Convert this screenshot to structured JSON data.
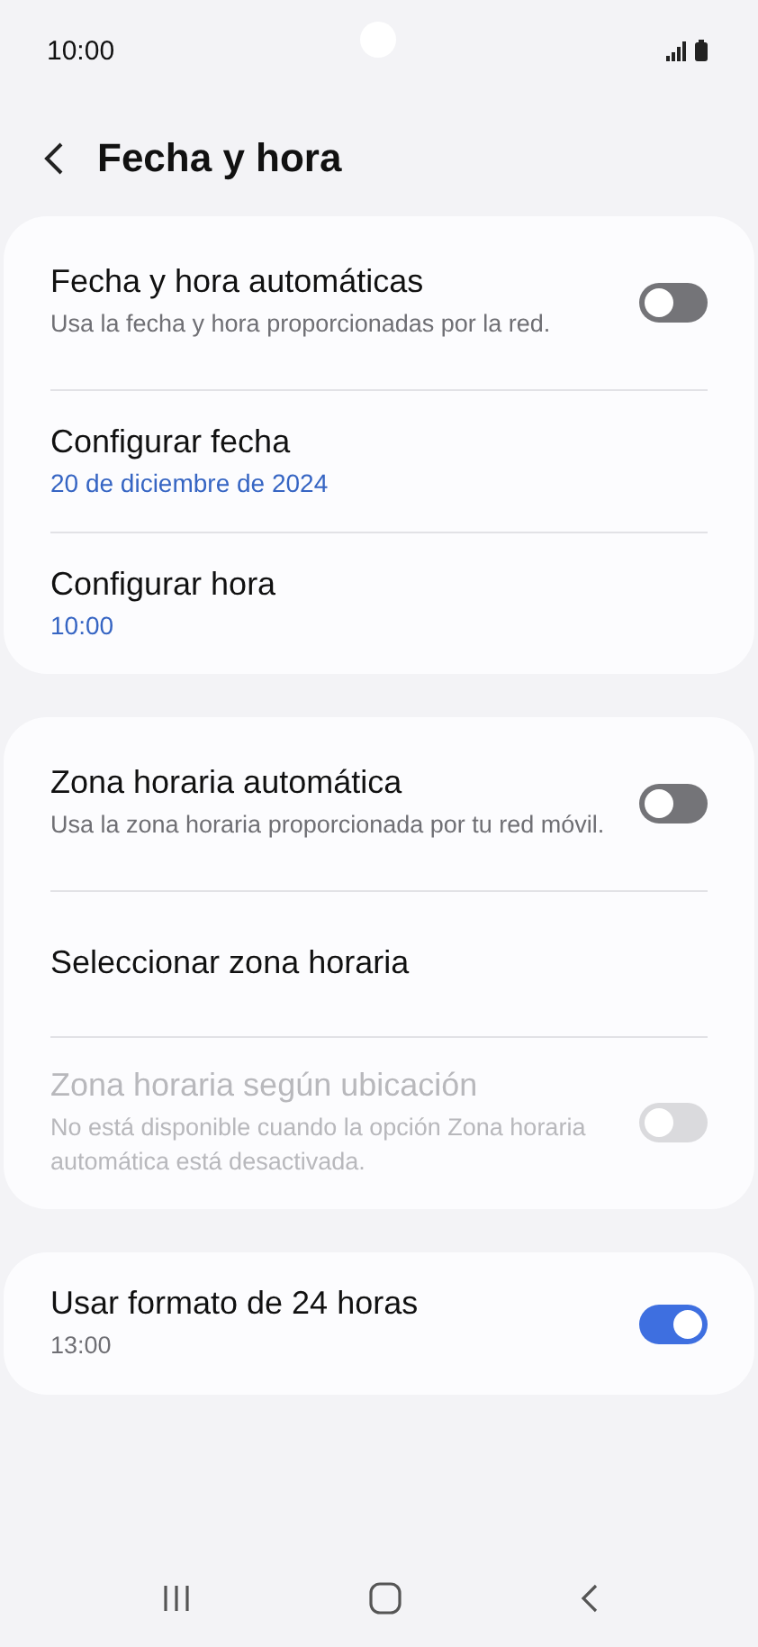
{
  "status_bar": {
    "time": "10:00"
  },
  "header": {
    "title": "Fecha y hora"
  },
  "sections": [
    {
      "items": [
        {
          "kind": "toggle",
          "title": "Fecha y hora automáticas",
          "subtitle": "Usa la fecha y hora proporcionadas por la red.",
          "on": false,
          "disabled": false
        },
        {
          "kind": "value",
          "title": "Configurar fecha",
          "value": "20 de diciembre de 2024"
        },
        {
          "kind": "value",
          "title": "Configurar hora",
          "value": "10:00"
        }
      ]
    },
    {
      "items": [
        {
          "kind": "toggle",
          "title": "Zona horaria automática",
          "subtitle": "Usa la zona horaria proporcionada por tu red móvil.",
          "on": false,
          "disabled": false
        },
        {
          "kind": "link",
          "title": "Seleccionar zona horaria"
        },
        {
          "kind": "toggle",
          "title": "Zona horaria según ubicación",
          "subtitle": "No está disponible cuando la opción Zona horaria automática está desactivada.",
          "on": false,
          "disabled": true
        }
      ]
    },
    {
      "items": [
        {
          "kind": "toggle",
          "title": "Usar formato de 24 horas",
          "subtitle": "13:00",
          "on": true,
          "disabled": false
        }
      ]
    }
  ]
}
